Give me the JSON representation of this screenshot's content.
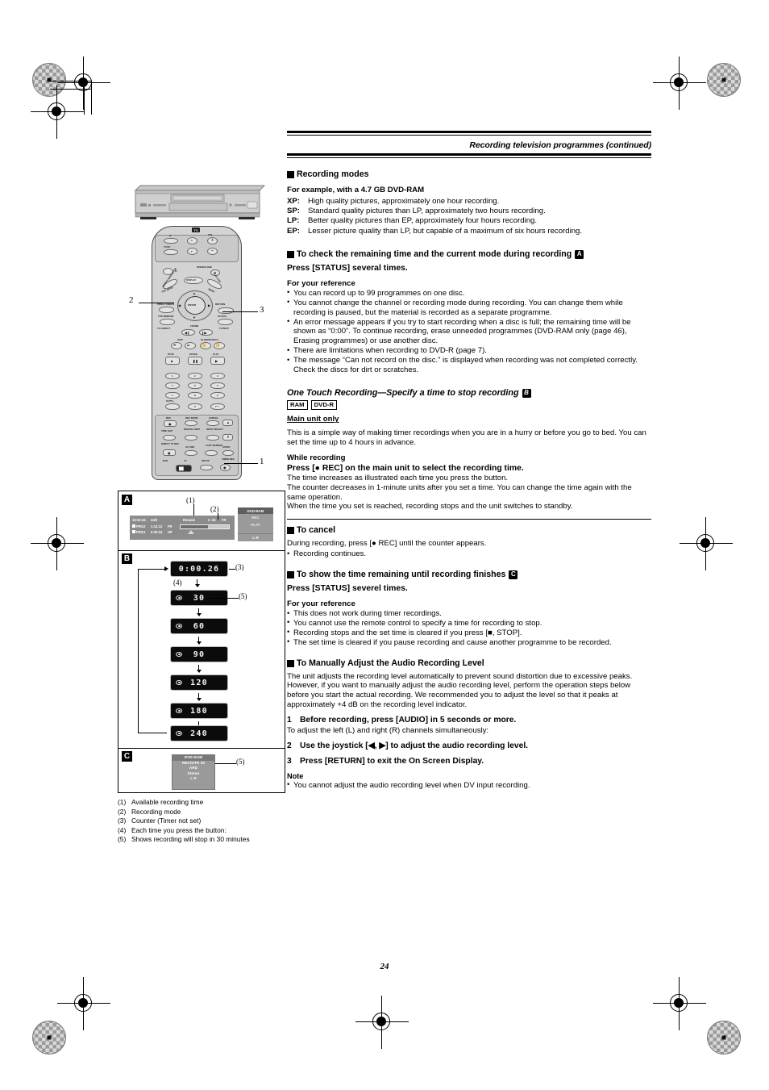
{
  "page": {
    "number": "24",
    "header_title": "Recording television programmes (continued)"
  },
  "sections": {
    "recording_modes": {
      "heading": "Recording modes",
      "example_line": "For example, with a 4.7 GB DVD-RAM",
      "modes": [
        {
          "key": "XP:",
          "desc": "High quality pictures, approximately one hour recording."
        },
        {
          "key": "SP:",
          "desc": "Standard quality pictures than LP, approximately two hours recording."
        },
        {
          "key": "LP:",
          "desc": "Better quality pictures than EP, approximately four hours recording."
        },
        {
          "key": "EP:",
          "desc": "Lesser picture quality than LP, but capable of a maximum of six hours recording."
        }
      ]
    },
    "check_remaining": {
      "heading": "To check the remaining time and the current mode during recording",
      "ref": "A",
      "instruction": "Press [STATUS] several times.",
      "reference_head": "For your reference",
      "bullets": [
        "You can record up to 99 programmes on one disc.",
        "You cannot change the channel or recording mode during recording. You can change them while recording is paused, but the material is recorded as a separate programme.",
        "An error message appears if you try to start recording when a disc is full; the remaining time will be shown as “0:00”. To continue recording, erase unneeded programmes (DVD-RAM only (page 46), Erasing programmes) or use another disc.",
        "There are limitations when recording to DVD-R (page 7).",
        "The message “Can not record on the disc.” is displayed when recording was not completed correctly. Check the discs for dirt or scratches."
      ]
    },
    "one_touch": {
      "heading": "One Touch Recording—Specify a time to stop recording",
      "ref": "B",
      "disc_tags": [
        "RAM",
        "DVD-R"
      ],
      "main_unit_only": "Main unit only",
      "intro": "This is a simple way of making timer recordings when you are in a hurry or before you go to bed. You can set the time up to 4 hours in advance.",
      "while_recording": "While recording",
      "press_rec": "Press [● REC] on the main unit to select the recording time.",
      "body": [
        "The time increases as illustrated each time you press the button.",
        "The counter decreases in 1-minute units after you set a time. You can change the time again with the same operation.",
        "When the time you set is reached, recording stops and the unit switches to standby."
      ]
    },
    "to_cancel": {
      "heading": "To cancel",
      "line": "During recording, press [● REC] until the counter appears.",
      "bullets": [
        "Recording continues."
      ]
    },
    "show_remaining": {
      "heading": "To show the time remaining until recording finishes",
      "ref": "C",
      "instruction": "Press [STATUS] severel times.",
      "reference_head": "For your reference",
      "bullets": [
        "This does not work during timer recordings.",
        "You cannot use the remote control to specify a time for recording to stop.",
        "Recording stops and the set time is cleared if you press [■, STOP].",
        "The set time is cleared if you pause recording and cause another programme to be recorded."
      ]
    },
    "audio_level": {
      "heading": "To Manually Adjust the Audio Recording Level",
      "body": [
        "The unit adjusts the recording level automatically to prevent sound distortion due to excessive peaks.",
        "However, if you want to manually adjust the audio recording level, perform the operation steps below before you start the actual recording. We recommended you to adjust the level so that it peaks at approximately +4 dB on the recording level indicator."
      ],
      "steps": [
        {
          "num": "1",
          "text": "Before recording, press [AUDIO] in 5 seconds or more.",
          "sub": "To adjust the left (L) and right (R) channels simultaneously:"
        },
        {
          "num": "2",
          "text": "Use the joystick [◀, ▶] to adjust the audio recording level.",
          "sub": ""
        },
        {
          "num": "3",
          "text": "Press [RETURN] to exit the On Screen Display.",
          "sub": ""
        }
      ],
      "note_head": "Note",
      "note_bullets": [
        "You cannot adjust the audio recording level when DV input recording."
      ]
    }
  },
  "figure": {
    "panel_letters": [
      "A",
      "B",
      "C"
    ],
    "callouts": [
      "1",
      "2",
      "3"
    ],
    "markers": [
      "(1)",
      "(2)",
      "(3)",
      "(4)",
      "(5)"
    ],
    "osd": {
      "clock": "15:32:54",
      "date": "24/9",
      "remain_label": "Remain",
      "remain_value": "2 :34",
      "mode": "FR",
      "programmes": [
        {
          "name": "PRG2",
          "time": "1:12.12",
          "mode": "FR"
        },
        {
          "name": "PRG1",
          "time": "0:30.04",
          "mode": "SP"
        }
      ],
      "side": {
        "disc": "DVD-RAM",
        "rec": "REC",
        "play": "PLAY",
        "channels": "L  R"
      }
    },
    "counters": [
      {
        "value": "0:00.26",
        "timer": false
      },
      {
        "value": "30",
        "timer": true
      },
      {
        "value": "60",
        "timer": true
      },
      {
        "value": "90",
        "timer": true
      },
      {
        "value": "120",
        "timer": true
      },
      {
        "value": "180",
        "timer": true
      },
      {
        "value": "240",
        "timer": true
      }
    ],
    "panel_c_display": [
      "DVD-RAM",
      "REC/OTR 30",
      "ARD",
      "Stereo",
      "L  R"
    ],
    "captions": [
      {
        "num": "(1)",
        "text": "Available recording time"
      },
      {
        "num": "(2)",
        "text": "Recording mode"
      },
      {
        "num": "(3)",
        "text": "Counter (Timer not set)"
      },
      {
        "num": "(4)",
        "text": "Each time you press the button:"
      },
      {
        "num": "(5)",
        "text": "Shows recording will stop in 30 minutes"
      }
    ]
  },
  "remote": {
    "labels": {
      "tv": "TV",
      "vol": "VOL",
      "tvav": "TV/AV",
      "open_close": "OPEN/CLOSE",
      "display": "DISPLAY",
      "menu": "MENU",
      "direct_navigator": "DIRECT NAVIGATOR",
      "top_menu": "TOP MENU",
      "play_list": "PLAY LIST",
      "enter": "ENTER",
      "return": "RETURN",
      "prog_check": "PROG / CHECK",
      "status": "STATUS",
      "top_window": "TOP WINDOW",
      "tv_aspect": "TV ASPECT",
      "tv_text": "TV/TEXT",
      "frame": "FRAME",
      "skip": "SKIP",
      "slow_search": "SLOW/SEARCH",
      "stop": "STOP",
      "pause": "PAUSE",
      "play": "PLAY",
      "sv_tv": "SV/TV+",
      "rec": "REC",
      "rec_mode": "REC MODE",
      "cancel": "CANCEL",
      "time_slip": "TIME SLIP",
      "manual_skip": "MANUAL SKIP",
      "input_select": "INPUT SELECT",
      "direct_tv_rec": "DIRECT TV REC",
      "avlink": "AV LINK",
      "last_marker": "LAST MARKER",
      "audio": "AUDIO",
      "setup": "SETUP",
      "timer_rec": "TIMER REC",
      "dvd": "DVD",
      "tv2": "TV"
    },
    "numbers": [
      "1",
      "2",
      "3",
      "4",
      "5",
      "6",
      "7",
      "8",
      "9",
      "0"
    ]
  }
}
